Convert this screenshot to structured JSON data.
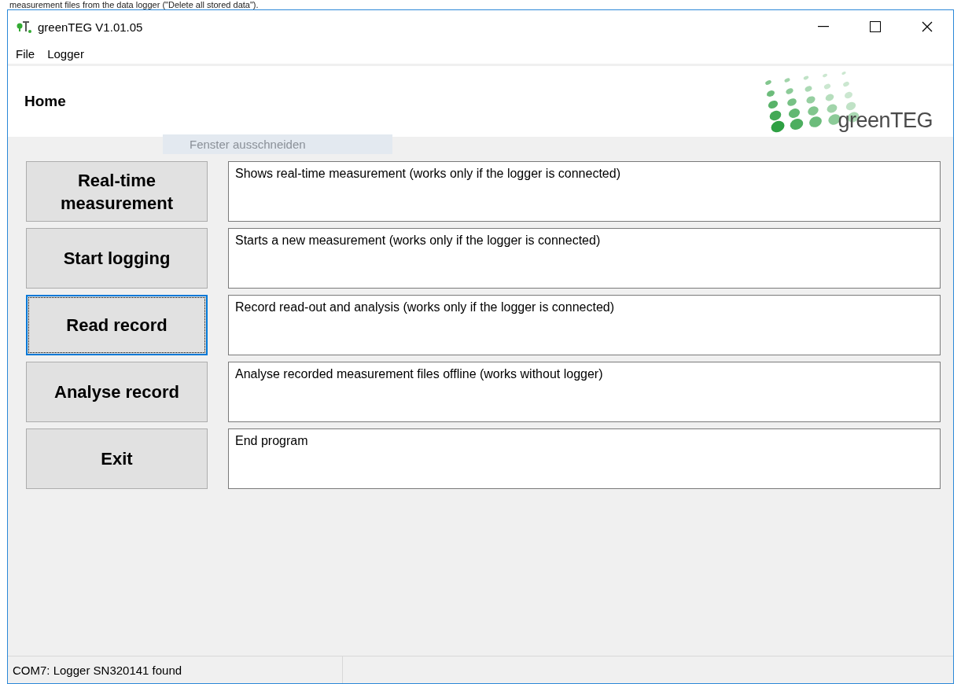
{
  "background_text": "measurement files from the data logger (\"Delete all stored data\").",
  "window": {
    "title": "greenTEG V1.01.05"
  },
  "menu": [
    "File",
    "Logger"
  ],
  "header": {
    "title": "Home",
    "logo_text": "greenTEG"
  },
  "overlay_label": "Fenster ausschneiden",
  "actions": [
    {
      "label": "Real-time measurement",
      "description": "Shows real-time measurement (works only if the logger is connected)",
      "focused": false
    },
    {
      "label": "Start logging",
      "description": "Starts a new measurement (works only if the logger is connected)",
      "focused": false
    },
    {
      "label": "Read record",
      "description": "Record read-out and analysis (works only if the logger is connected)",
      "focused": true
    },
    {
      "label": "Analyse record",
      "description": "Analyse recorded measurement files offline (works without logger)",
      "focused": false
    },
    {
      "label": "Exit",
      "description": "End program",
      "focused": false
    }
  ],
  "status_bar": {
    "message": "COM7: Logger SN320141 found"
  }
}
